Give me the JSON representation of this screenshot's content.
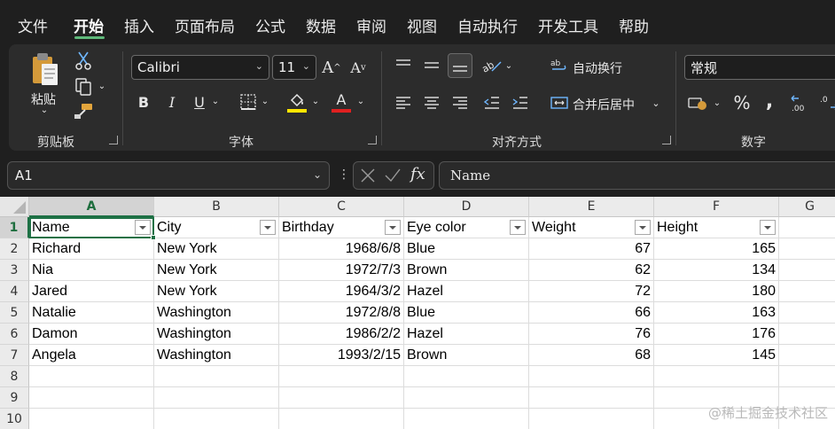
{
  "menu": {
    "tabs": [
      "文件",
      "开始",
      "插入",
      "页面布局",
      "公式",
      "数据",
      "审阅",
      "视图",
      "自动执行",
      "开发工具",
      "帮助"
    ],
    "active": "开始"
  },
  "ribbon": {
    "clipboard": {
      "paste_label": "粘贴",
      "group_label": "剪贴板"
    },
    "font": {
      "name": "Calibri",
      "size": "11",
      "group_label": "字体",
      "highlight_color": "#ffe600",
      "font_color": "#e02020"
    },
    "alignment": {
      "wrap_text": "自动换行",
      "merge_center": "合并后居中",
      "group_label": "对齐方式"
    },
    "number": {
      "format": "常规",
      "group_label": "数字"
    }
  },
  "formula_bar": {
    "name_box": "A1",
    "formula": "Name"
  },
  "sheet": {
    "columns": [
      "A",
      "B",
      "C",
      "D",
      "E",
      "F",
      "G"
    ],
    "rows": [
      "1",
      "2",
      "3",
      "4",
      "5",
      "6",
      "7",
      "8",
      "9",
      "10"
    ],
    "headers": [
      "Name",
      "City",
      "Birthday",
      "Eye color",
      "Weight",
      "Height"
    ],
    "data": [
      [
        "Richard",
        "New York",
        "1968/6/8",
        "Blue",
        "67",
        "165"
      ],
      [
        "Nia",
        "New York",
        "1972/7/3",
        "Brown",
        "62",
        "134"
      ],
      [
        "Jared",
        "New York",
        "1964/3/2",
        "Hazel",
        "72",
        "180"
      ],
      [
        "Natalie",
        "Washington",
        "1972/8/8",
        "Blue",
        "66",
        "163"
      ],
      [
        "Damon",
        "Washington",
        "1986/2/2",
        "Hazel",
        "76",
        "176"
      ],
      [
        "Angela",
        "Washington",
        "1993/2/15",
        "Brown",
        "68",
        "145"
      ]
    ],
    "accent_color": "#1e7145"
  },
  "watermark": "@稀土掘金技术社区"
}
